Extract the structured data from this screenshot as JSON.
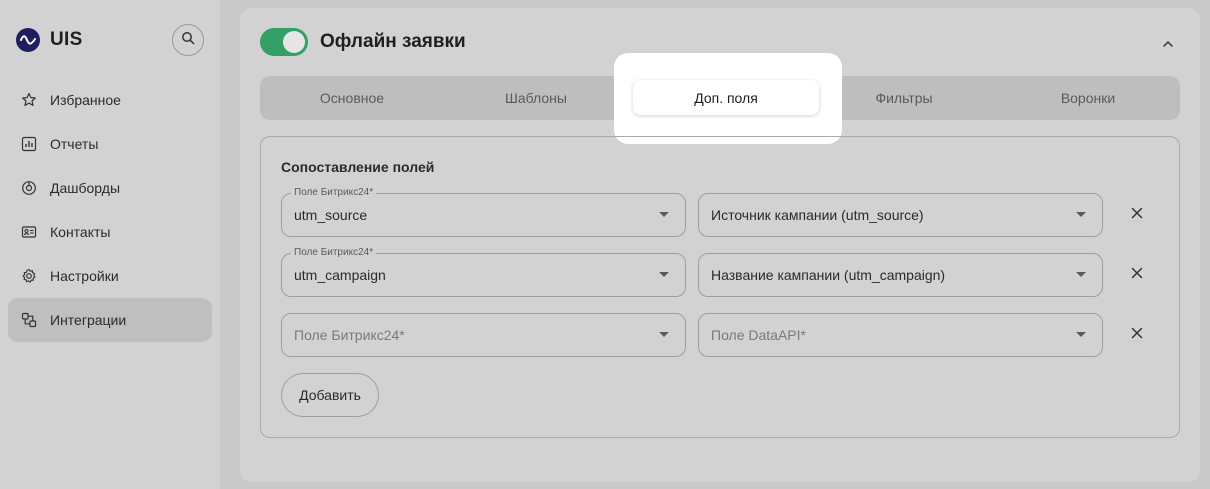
{
  "brand": {
    "name": "UIS",
    "logo_icon": "uis-wave-logo"
  },
  "sidebar": {
    "search_icon": "search-icon",
    "items": [
      {
        "label": "Избранное",
        "icon": "star-icon",
        "active": false
      },
      {
        "label": "Отчеты",
        "icon": "chart-icon",
        "active": false
      },
      {
        "label": "Дашборды",
        "icon": "dashboard-icon",
        "active": false
      },
      {
        "label": "Контакты",
        "icon": "contacts-icon",
        "active": false
      },
      {
        "label": "Настройки",
        "icon": "gear-icon",
        "active": false
      },
      {
        "label": "Интеграции",
        "icon": "integrations-icon",
        "active": true
      }
    ]
  },
  "header": {
    "title": "Офлайн заявки",
    "toggle_on": true,
    "collapse_icon": "chevron-up-icon"
  },
  "tabs": [
    {
      "label": "Основное"
    },
    {
      "label": "Шаблоны"
    },
    {
      "label": "Доп. поля",
      "active": true
    },
    {
      "label": "Фильтры"
    },
    {
      "label": "Воронки"
    }
  ],
  "mapping": {
    "title": "Сопоставление полей",
    "rows": [
      {
        "left": {
          "label": "Поле Битрикс24*",
          "value": "utm_source"
        },
        "right": {
          "value": "Источник кампании (utm_source)"
        }
      },
      {
        "left": {
          "label": "Поле Битрикс24*",
          "value": "utm_campaign"
        },
        "right": {
          "value": "Название кампании (utm_campaign)"
        }
      },
      {
        "left": {
          "placeholder": "Поле Битрикс24*"
        },
        "right": {
          "placeholder": "Поле DataAPI*"
        }
      }
    ],
    "add_label": "Добавить"
  },
  "colors": {
    "toggle_on": "#34a065",
    "logo_bg": "#1d1f5e",
    "overlay_bg": "#c9c9c9",
    "highlight": "#ffffff"
  }
}
